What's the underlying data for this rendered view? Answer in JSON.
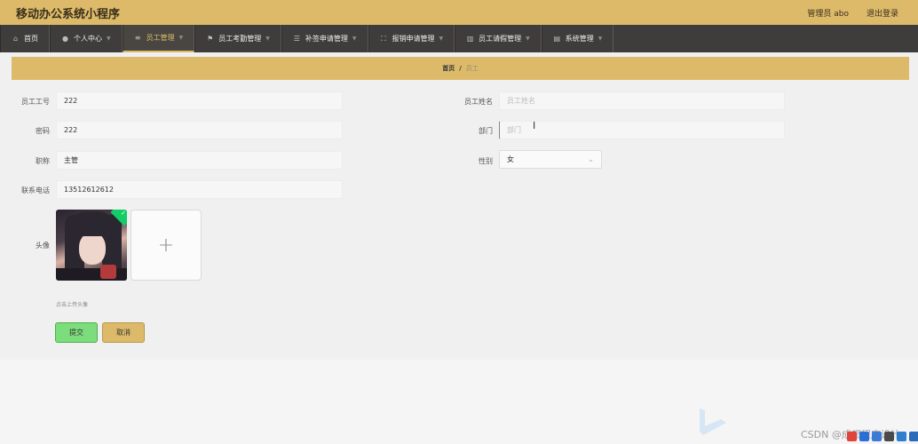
{
  "app": {
    "title": "移动办公系统小程序",
    "user_label": "管理员 abo",
    "logout_label": "退出登录"
  },
  "nav": {
    "items": [
      {
        "label": "首页",
        "icon": "home-icon"
      },
      {
        "label": "个人中心",
        "icon": "user-icon"
      },
      {
        "label": "员工管理",
        "icon": "list-icon"
      },
      {
        "label": "员工考勤管理",
        "icon": "flag-icon"
      },
      {
        "label": "补签申请管理",
        "icon": "menu-icon"
      },
      {
        "label": "报销申请管理",
        "icon": "expand-icon"
      },
      {
        "label": "员工请假管理",
        "icon": "chart-icon"
      },
      {
        "label": "系统管理",
        "icon": "doc-icon"
      }
    ],
    "active_index": 2
  },
  "breadcrumb": {
    "home": "首页",
    "separator": "/",
    "current": "员工"
  },
  "form": {
    "employee_id": {
      "label": "员工工号",
      "value": "222"
    },
    "employee_name": {
      "label": "员工姓名",
      "value": "",
      "placeholder": "员工姓名"
    },
    "password": {
      "label": "密码",
      "value": "222"
    },
    "department": {
      "label": "部门",
      "value": "",
      "placeholder": "部门"
    },
    "title": {
      "label": "职称",
      "value": "主管"
    },
    "gender": {
      "label": "性别",
      "value": "女"
    },
    "phone": {
      "label": "联系电话",
      "value": "13512612612"
    },
    "avatar": {
      "label": "头像",
      "hint": "点击上传头像"
    }
  },
  "buttons": {
    "submit": "提交",
    "cancel": "取消"
  },
  "watermark": {
    "text": "CSDN @成都程序设计"
  },
  "colors": {
    "accent": "#dcba6a",
    "nav_bg": "#3f3d3b",
    "submit": "#7cdd7c"
  }
}
